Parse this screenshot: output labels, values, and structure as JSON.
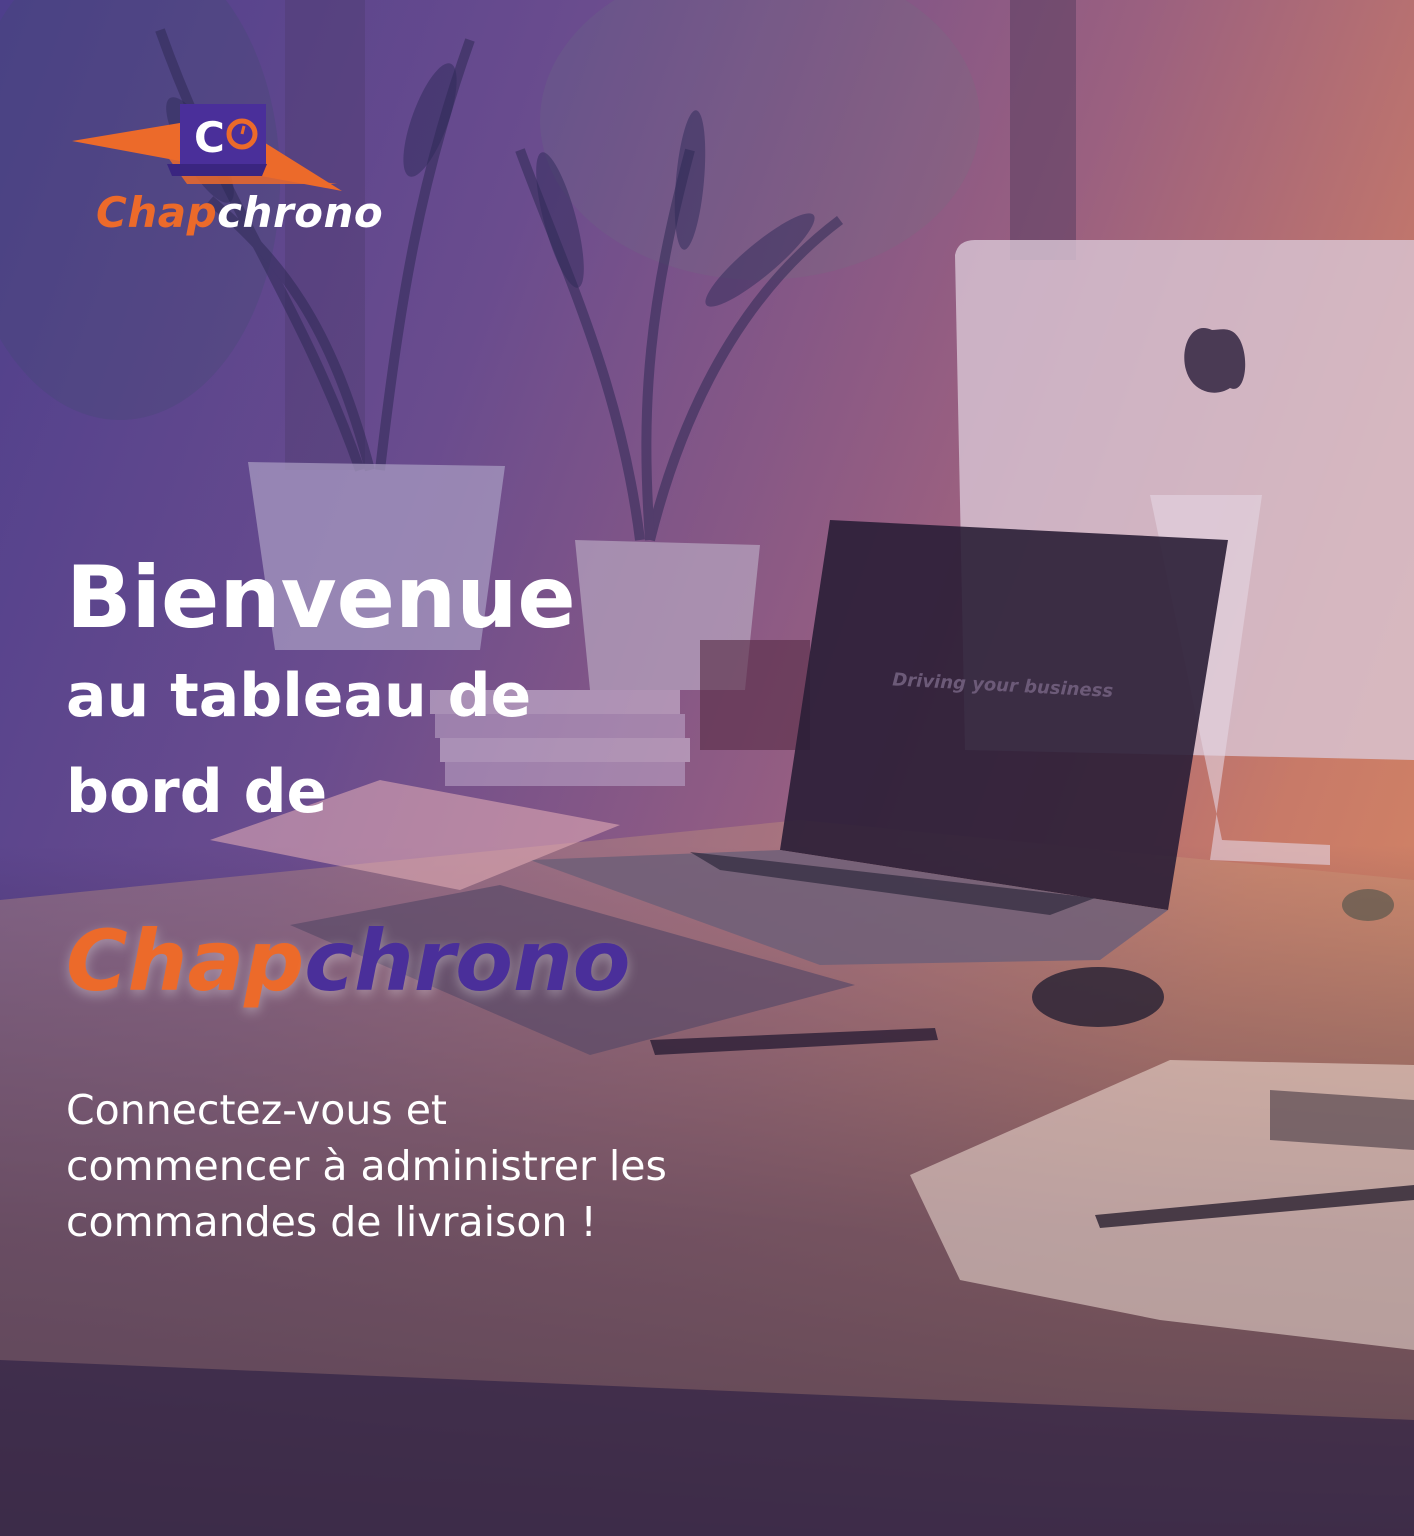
{
  "logo": {
    "mark_letter": "C",
    "word_part1": "Chap",
    "word_part2": "chrono"
  },
  "hero": {
    "title_line1": "Bienvenue",
    "title_line2": "au tableau de",
    "title_line3": "bord de",
    "brand_part1": "Chap",
    "brand_part2": "chrono",
    "subtitle_line1": "Connectez-vous et",
    "subtitle_line2": "commencer à administrer les",
    "subtitle_line3": "commandes de livraison !"
  },
  "background": {
    "screen_text": "Driving your business"
  },
  "colors": {
    "accent_orange": "#ec6a2a",
    "brand_purple": "#4a2f9a",
    "overlay_left": "#4e3f8c",
    "overlay_right": "#d98a62"
  }
}
